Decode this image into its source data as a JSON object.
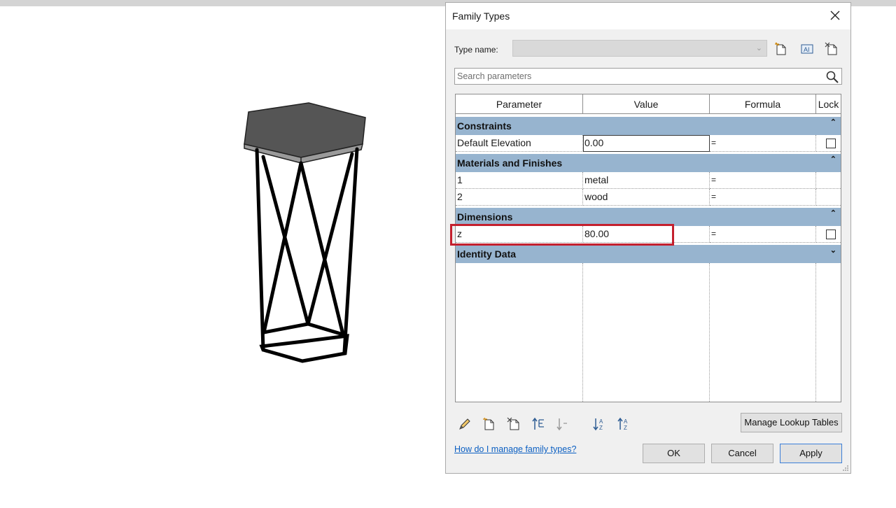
{
  "dialog": {
    "title": "Family Types",
    "type_name_label": "Type name:",
    "type_name_value": "",
    "search_placeholder": "Search parameters",
    "columns": [
      "Parameter",
      "Value",
      "Formula",
      "Lock"
    ],
    "groups": [
      {
        "label": "Constraints",
        "toggle": "⌃",
        "rows": [
          {
            "parameter": "Default Elevation",
            "value": "0.00",
            "formula": "=",
            "lock": "checkbox"
          }
        ]
      },
      {
        "label": "Materials and Finishes",
        "toggle": "⌃",
        "rows": [
          {
            "parameter": "1",
            "value": "metal",
            "formula": "="
          },
          {
            "parameter": "2",
            "value": "wood",
            "formula": "="
          }
        ]
      },
      {
        "label": "Dimensions",
        "toggle": "⌃",
        "rows": [
          {
            "parameter": "z",
            "value": "80.00",
            "formula": "=",
            "lock": "checkbox"
          }
        ]
      },
      {
        "label": "Identity Data",
        "toggle": "⌄",
        "rows": []
      }
    ],
    "manage_lookup_label": "Manage Lookup Tables",
    "help_link": "How do I manage family types?",
    "ok_label": "OK",
    "cancel_label": "Cancel",
    "apply_label": "Apply"
  },
  "icons": {
    "toolbar": [
      "new-type-icon",
      "rename-type-icon",
      "delete-type-icon"
    ],
    "bottom": [
      "edit-parameter-icon",
      "new-parameter-icon",
      "delete-parameter-icon",
      "move-up-icon",
      "move-down-icon",
      "sort-ascending-icon",
      "sort-descending-icon"
    ]
  },
  "colors": {
    "group_header": "#97b4cf",
    "highlight": "#c4202e",
    "link": "#0b5fc2"
  }
}
